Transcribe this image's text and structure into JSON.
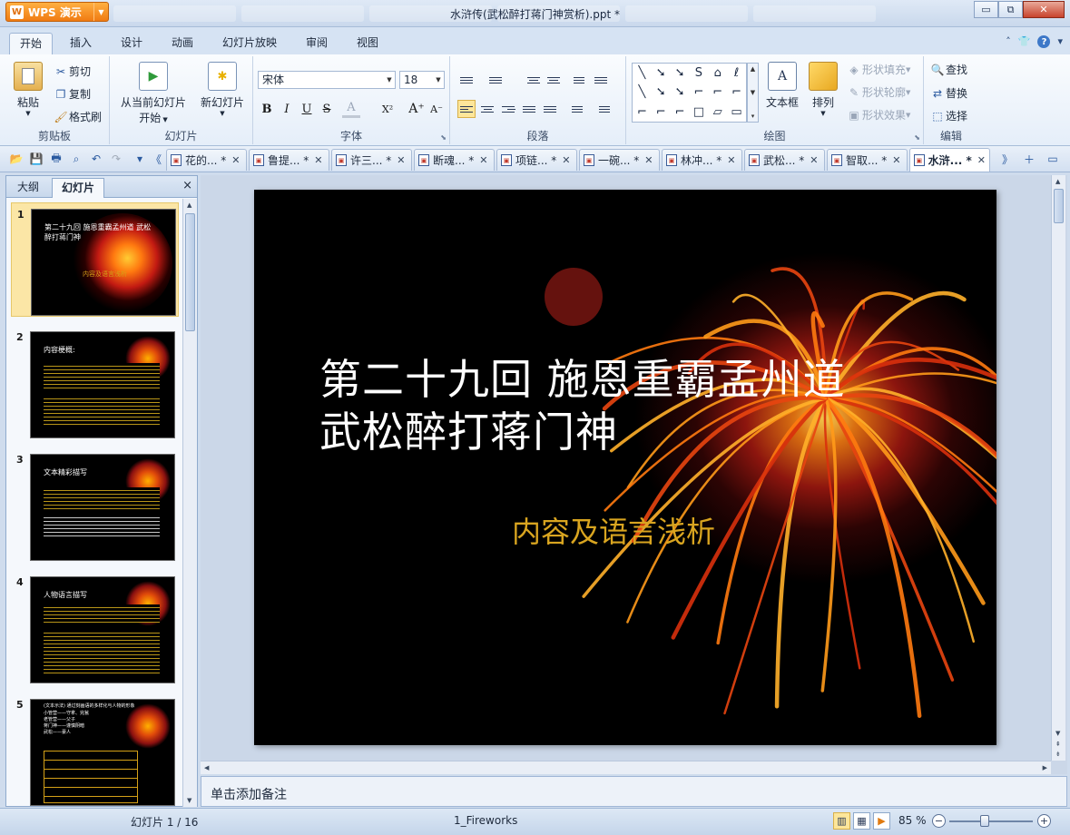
{
  "app": {
    "name": "WPS 演示",
    "logo": "W",
    "window_title": "水浒传(武松醉打蒋门神赏析).ppt *"
  },
  "window_controls": {
    "minimize": "▭",
    "restore": "⧉",
    "close": "✕"
  },
  "ribbon_tabs": [
    "开始",
    "插入",
    "设计",
    "动画",
    "幻灯片放映",
    "审阅",
    "视图"
  ],
  "ribbon_right": {
    "up_glyph": "˄",
    "help_glyph": "?"
  },
  "ribbon": {
    "clipboard": {
      "label": "剪贴板",
      "paste": "粘贴",
      "cut": "剪切",
      "copy": "复制",
      "format_painter": "格式刷"
    },
    "slides": {
      "label": "幻灯片",
      "from_current": "从当前幻灯片",
      "start": "开始",
      "new_slide": "新幻灯片"
    },
    "font": {
      "label": "字体",
      "font_name": "宋体",
      "font_size": "18",
      "bold": "B",
      "italic": "I",
      "underline": "U",
      "strike": "S",
      "color": "A",
      "superscript": "X²",
      "grow": "A⁺",
      "shrink": "A⁻"
    },
    "paragraph": {
      "label": "段落"
    },
    "drawing": {
      "label": "绘图",
      "text_box": "文本框",
      "arrange": "排列",
      "shape_fill": "形状填充",
      "shape_outline": "形状轮廓",
      "shape_effect": "形状效果",
      "gallery": [
        "╲",
        "➘",
        "➘",
        "S",
        "⌂",
        "ℓ",
        "╲",
        "➘",
        "➘",
        "⌐",
        "⌐",
        "⌐",
        "⌐",
        "⌐",
        "⌐",
        "□",
        "▱",
        "▭"
      ]
    },
    "editing": {
      "label": "编辑",
      "find": "查找",
      "replace": "替换",
      "select": "选择"
    }
  },
  "doc_tabs": [
    {
      "label": "花的... *",
      "active": false
    },
    {
      "label": "鲁提... *",
      "active": false
    },
    {
      "label": "许三... *",
      "active": false
    },
    {
      "label": "断魂... *",
      "active": false
    },
    {
      "label": "项链... *",
      "active": false
    },
    {
      "label": "一碗... *",
      "active": false
    },
    {
      "label": "林冲... *",
      "active": false
    },
    {
      "label": "武松... *",
      "active": false
    },
    {
      "label": "智取... *",
      "active": false
    },
    {
      "label": "水浒... *",
      "active": true
    }
  ],
  "left_pane": {
    "tabs": [
      "大纲",
      "幻灯片"
    ],
    "close": "×",
    "thumbnails": [
      {
        "num": "1",
        "title": "第二十九回 施恩重霸孟州道 武松醉打蒋门神",
        "sub": "内容及语言浅析"
      },
      {
        "num": "2",
        "title": "内容梗概:"
      },
      {
        "num": "3",
        "title": "文本精彩描写"
      },
      {
        "num": "4",
        "title": "人物语言描写"
      },
      {
        "num": "5",
        "title": "(文本示法) 通过刻画语的多样化与人物的形象",
        "lines": [
          "小管营——守拿、完瓮",
          "老管营——父子",
          "蒋门神——谨慎阴暗",
          "武松——豪人"
        ]
      }
    ]
  },
  "slide": {
    "title_line1": "第二十九回  施恩重霸孟州道",
    "title_line2": "武松醉打蒋门神",
    "subtitle": "内容及语言浅析"
  },
  "notes_placeholder": "单击添加备注",
  "status": {
    "slide_counter": "幻灯片 1 / 16",
    "theme": "1_Fireworks",
    "zoom": "85 %"
  },
  "colors": {
    "accent": "#f07b12",
    "subtitle": "#d9a520",
    "ribbon_bg": "#e5eef9",
    "selected_thumb": "#fbe6a6"
  }
}
